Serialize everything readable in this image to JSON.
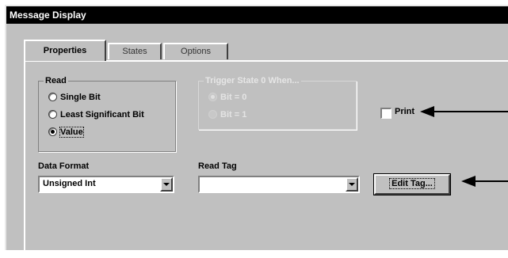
{
  "window": {
    "title": "Message Display"
  },
  "tabs": [
    {
      "label": "Properties",
      "active": true
    },
    {
      "label": "States",
      "active": false
    },
    {
      "label": "Options",
      "active": false
    }
  ],
  "read_group": {
    "legend": "Read",
    "options": [
      {
        "label": "Single Bit",
        "checked": false
      },
      {
        "label": "Least Significant Bit",
        "checked": false
      },
      {
        "label": "Value",
        "checked": true
      }
    ]
  },
  "trigger_group": {
    "legend": "Trigger State 0 When...",
    "disabled": true,
    "options": [
      {
        "label": "Bit = 0",
        "checked": true
      },
      {
        "label": "Bit = 1",
        "checked": false
      }
    ]
  },
  "print": {
    "label": "Print",
    "checked": false
  },
  "data_format": {
    "label": "Data Format",
    "value": "Unsigned Int"
  },
  "read_tag": {
    "label": "Read Tag",
    "value": ""
  },
  "edit_tag": {
    "label": "Edit Tag..."
  },
  "icons": {
    "dropdown": "chevron-down-icon",
    "pointer": "arrow-left-icon"
  }
}
